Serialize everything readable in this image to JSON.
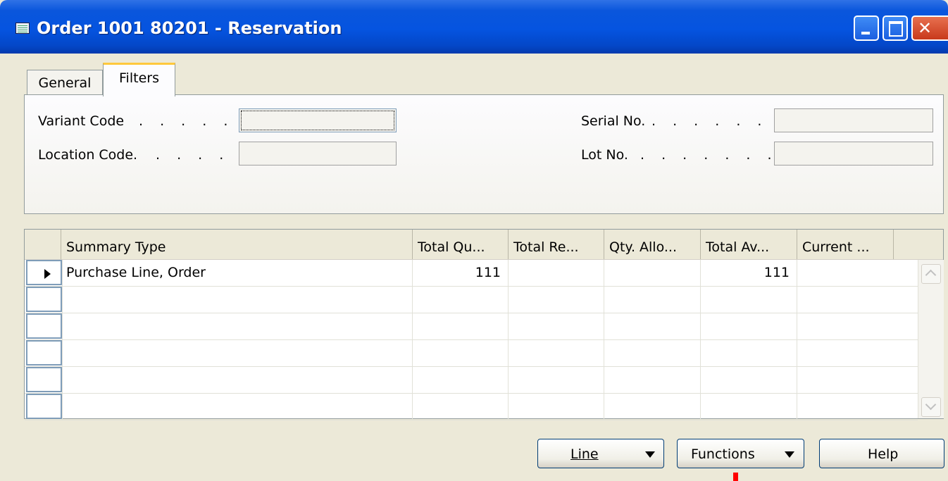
{
  "window": {
    "title": "Order 1001 80201 - Reservation"
  },
  "tabs": [
    {
      "label": "General"
    },
    {
      "label": "Filters"
    }
  ],
  "filters": {
    "variant_code_label": "Variant Code",
    "location_code_label": "Location Code.",
    "serial_no_label": "Serial No.",
    "lot_no_label": "Lot No.",
    "dots_left_1": ". . . . . . .",
    "dots_left_2": ". . . . . .",
    "dots_right": ". . . . . . . . .",
    "variant_code_value": "",
    "location_code_value": "",
    "serial_no_value": "",
    "lot_no_value": ""
  },
  "grid": {
    "columns": [
      "Summary Type",
      "Total Qu...",
      "Total Re...",
      "Qty. Allo...",
      "Total Av...",
      "Current ..."
    ],
    "rows": [
      [
        "Purchase Line, Order",
        "111",
        "",
        "",
        "111",
        ""
      ],
      [
        "",
        "",
        "",
        "",
        "",
        ""
      ],
      [
        "",
        "",
        "",
        "",
        "",
        ""
      ],
      [
        "",
        "",
        "",
        "",
        "",
        ""
      ],
      [
        "",
        "",
        "",
        "",
        "",
        ""
      ],
      [
        "",
        "",
        "",
        "",
        "",
        ""
      ]
    ]
  },
  "buttons": {
    "line": "Line",
    "functions": "Functions",
    "help": "Help"
  },
  "colors": {
    "titlebar": "#0554e0",
    "active_tab_accent": "#ffc83c",
    "annotation": "#ff0000"
  }
}
